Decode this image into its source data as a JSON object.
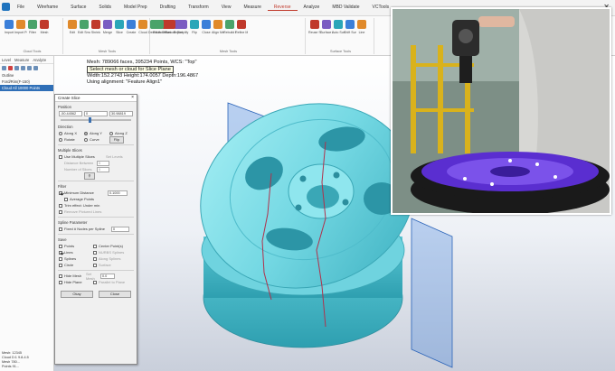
{
  "menubar": {
    "tabs": [
      "File",
      "Wireframe",
      "Surface",
      "Solids",
      "Model Prep",
      "Drafting",
      "Transform",
      "View",
      "Measure",
      "Reverse",
      "Analyze",
      "MBD Validate",
      "VCTools"
    ],
    "active_tab": "Reverse"
  },
  "ribbon": {
    "groups": [
      {
        "name": "Cloud Tools",
        "tools": [
          "Import",
          "Import Preferences",
          "Filter",
          "Mesh"
        ]
      },
      {
        "name": "Mesh Tools",
        "tools": [
          "Edit",
          "Edit Smooth",
          "Shrink",
          "Merge",
          "Slice",
          "Create",
          "Cloud",
          "Decimate",
          "Offset",
          "Export"
        ]
      },
      {
        "name": "Mesh Tools",
        "tools": [
          "Fill Holes",
          "Smooth",
          "Simplify",
          "Flip",
          "Close",
          "Align Mesh",
          "Rebuild Mesh",
          "Refine Mesh"
        ]
      },
      {
        "name": "Surface Tools",
        "tools": [
          "Reuse Surface",
          "Surface Mesh",
          "Auto Surface",
          "Shift Surface",
          "Line"
        ]
      }
    ]
  },
  "left_panel": {
    "tabs": [
      "Level",
      "Measure",
      "Analyze"
    ],
    "items": [
      "Outline",
      "Ford/Rim(F-150)",
      "Cloud All 10000 Points"
    ],
    "selected_index": 2,
    "footer": [
      "Mesh: 12345",
      "Cloud D:1 9.8-4.5",
      "Mesh 780...",
      "Points 91..."
    ]
  },
  "viewport": {
    "info_lines": [
      "Mesh: 789066 faces, 395234 Points, WCS: \"Top\"",
      "Select mesh or cloud for Slice Plane",
      "Width:152.2743 Height:174.0057 Depth:196.4867",
      "Using alignment: \"Feature Align1\""
    ]
  },
  "dialog": {
    "title": "Create Slice",
    "position_label": "Position",
    "position_fields": [
      "-50.44562",
      "0",
      "30.98819"
    ],
    "direction_label": "Direction",
    "direction_options": [
      "Along X",
      "Along Y",
      "Along Z",
      "Rotate",
      "Curve"
    ],
    "direction_selected": "Along Y",
    "direction_button": "Flip",
    "multiple_label": "Multiple Slices",
    "multiple_check": "Use Multiple Slices",
    "multiple_button": "Set Levels",
    "distance_label": "Distance Between",
    "distance_value": "5",
    "number_label": "Number of Slices",
    "number_value": "5",
    "filter_label": "Filter",
    "min_distance_label": "Minimum Distance",
    "min_distance_value": "0.1000",
    "average_points": "Average Points",
    "trim_effect": "Trim effect: Under min",
    "remove_pictured": "Remove Pictured Lines",
    "spline_label": "Spline Parameter",
    "spline_fixed": "Fixed # Nodes per Spline",
    "spline_value": "0",
    "save_label": "Save",
    "save_points": "Points",
    "save_center": "Center Point(s)",
    "save_lines": "Lines",
    "save_single_lines": "NURBS Splines",
    "save_splines": "Splines",
    "save_along": "Along Splines",
    "save_circle": "Circle",
    "save_surface": "Surface",
    "hide_mesh": "Hide Mesh",
    "hide_mesh_sub": "Set Mesh",
    "hide_mesh_value": "0.0",
    "hide_plane": "Hide Plane",
    "plane_to_plane": "Parallel to Plane",
    "buttons": [
      "Okay",
      "Close"
    ]
  },
  "colors": {
    "mesh": "#79dfe8",
    "mesh_dark": "#38a9b8",
    "slice_plane": "#3b7fd9",
    "accent_tab": "#c0392b"
  }
}
